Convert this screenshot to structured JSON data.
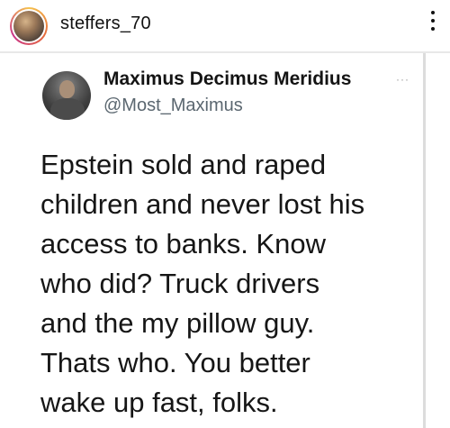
{
  "instagram_post": {
    "username": "steffers_70",
    "more_icon": "vertical-ellipsis-icon"
  },
  "tweet": {
    "display_name": "Maximus Decimus Meridius",
    "handle": "@Most_Maximus",
    "more_icon": "horizontal-ellipsis-icon",
    "more_glyph": "···",
    "text_lines": [
      "Epstein sold and raped",
      "children and never lost his",
      "access to banks. Know",
      "who did? Truck drivers",
      "and the my pillow guy.",
      "Thats who. You better",
      "wake up fast, folks."
    ]
  }
}
